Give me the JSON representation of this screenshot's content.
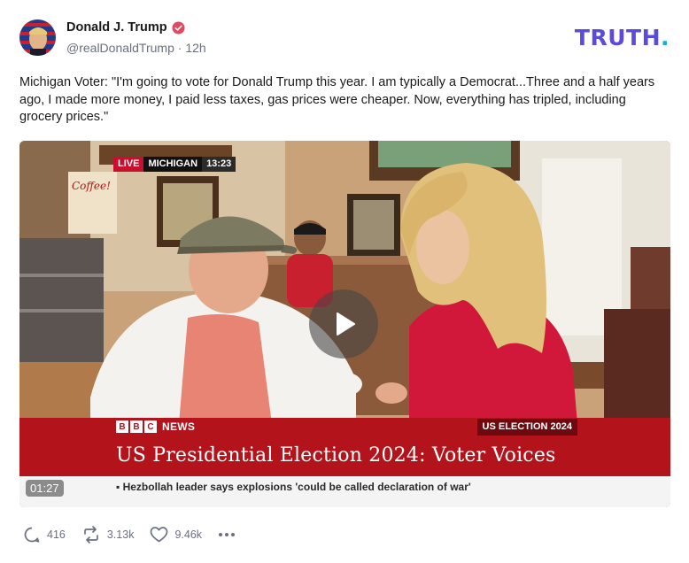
{
  "author": {
    "name": "Donald J. Trump",
    "handle": "@realDonaldTrump",
    "separator": "·",
    "time": "12h"
  },
  "brand": {
    "logo_text": "TRUTH",
    "logo_dot": "."
  },
  "post": {
    "text": "Michigan Voter: \"I'm going to vote for Donald Trump this year. I am typically a Democrat...Three and a half years ago, I made more money, I paid less taxes, gas prices were cheaper. Now, everything has tripled, including grocery prices.\""
  },
  "video": {
    "duration": "01:27",
    "live_label": "LIVE",
    "location": "MICHIGAN",
    "clock": "13:23",
    "news_brand_letters": [
      "B",
      "B",
      "C"
    ],
    "news_brand_word": "NEWS",
    "election_tag": "US ELECTION 2024",
    "headline": "US Presidential Election 2024: Voter Voices",
    "ticker": "▪ Hezbollah leader says explosions 'could be called declaration of war'",
    "poster_text": "Coffee!"
  },
  "actions": {
    "replies": "416",
    "retruths": "3.13k",
    "likes": "9.46k",
    "more_icon": "ellipsis-icon"
  },
  "colors": {
    "brand_purple": "#5b4bdb",
    "brand_teal": "#10b3c9",
    "verified": "#e8455f",
    "bbc_red": "#b3131a",
    "muted": "#6b6f80"
  }
}
